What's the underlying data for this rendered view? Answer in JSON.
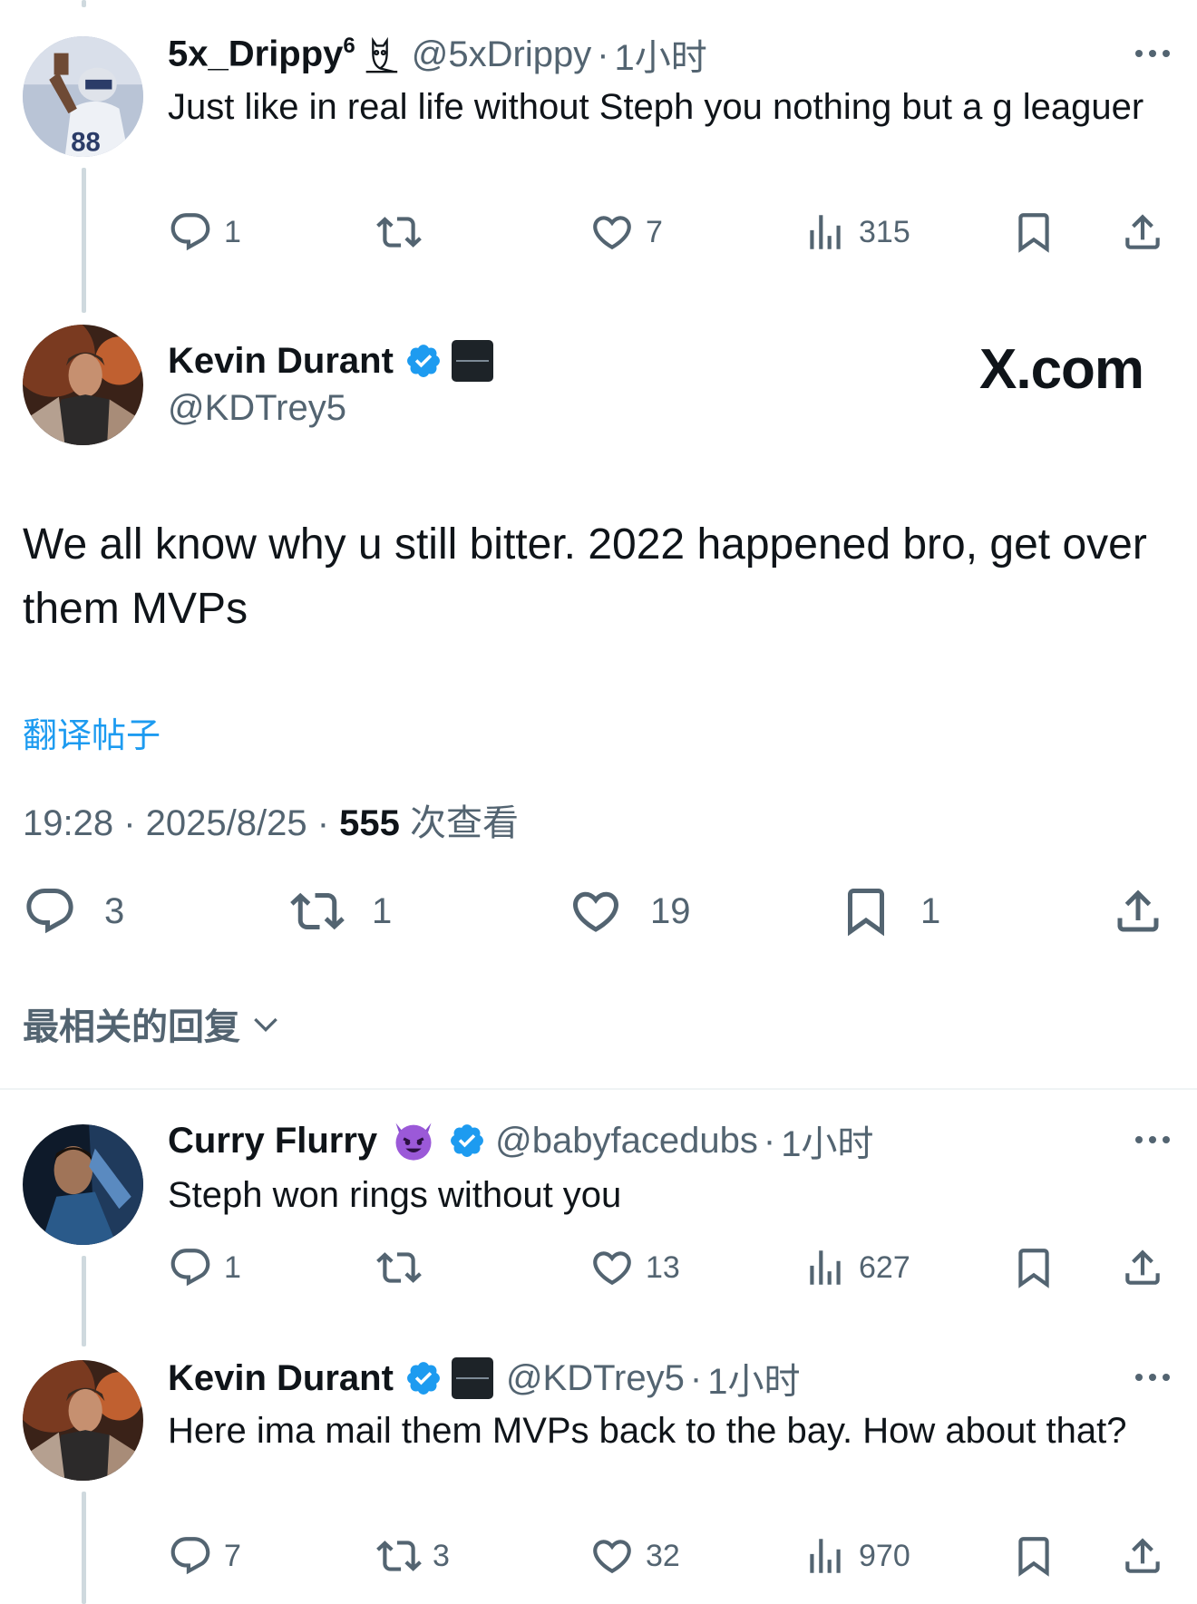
{
  "reply1": {
    "name": "5x_Drippy",
    "name_sup": "6",
    "handle": "@5xDrippy",
    "time": "1小时",
    "text": "Just like in real life without Steph you nothing but a g leaguer",
    "replies": "1",
    "retweets": "",
    "likes": "7",
    "views": "315"
  },
  "main": {
    "name": "Kevin Durant",
    "handle": "@KDTrey5",
    "watermark": "X.com",
    "text": "We all know why u still bitter. 2022 happened bro, get over them MVPs",
    "translate_link": "翻译帖子",
    "time": "19:28",
    "date": "2025/8/25",
    "views_count": "555",
    "views_label": "次查看",
    "replies": "3",
    "retweets": "1",
    "likes": "19",
    "bookmarks": "1"
  },
  "sort": {
    "label": "最相关的回复"
  },
  "reply2": {
    "name": "Curry Flurry",
    "emoji": "😈",
    "handle": "@babyfacedubs",
    "time": "1小时",
    "text": "Steph won rings without you",
    "replies": "1",
    "retweets": "",
    "likes": "13",
    "views": "627"
  },
  "reply3": {
    "name": "Kevin Durant",
    "handle": "@KDTrey5",
    "time": "1小时",
    "text": "Here ima mail them MVPs back to the bay. How about that?",
    "replies": "7",
    "retweets": "3",
    "likes": "32",
    "views": "970"
  },
  "colors": {
    "text": "#0f1419",
    "secondary": "#536471",
    "link": "#1d9bf0",
    "verified": "#1d9bf0",
    "divider": "#eff3f4",
    "thread_line": "#cfd9de"
  },
  "icons": [
    "reply-icon",
    "retweet-icon",
    "like-icon",
    "views-icon",
    "bookmark-icon",
    "share-icon",
    "verified-icon",
    "more-icon",
    "chevron-down-icon",
    "owl-icon",
    "boardroom-badge"
  ]
}
